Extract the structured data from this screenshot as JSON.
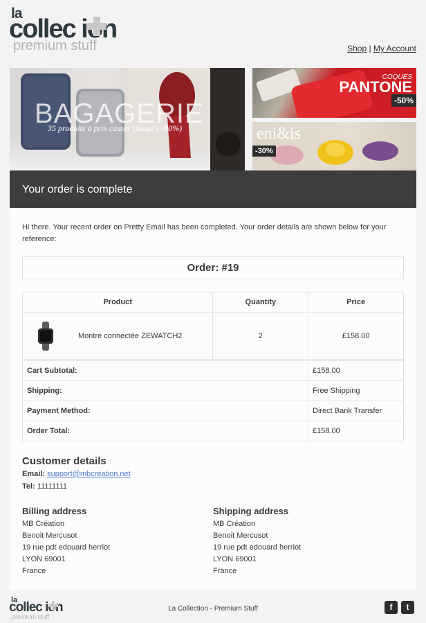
{
  "header": {
    "logo_top": "la",
    "logo_word": "collec ion",
    "logo_tagline": "premium stuff",
    "links": [
      {
        "label": "Shop"
      },
      {
        "label": "My Account"
      }
    ],
    "separator": "|"
  },
  "banner": {
    "main_title": "BAGAGERIE",
    "main_promo": "35 produits à prix cassés (jusqu'à -80%)",
    "right_top_small": "COQUES",
    "right_top_brand": "PANTONE",
    "right_top_discount": "-50%",
    "right_bottom_brand": "eni&is",
    "right_bottom_discount": "-30%"
  },
  "email": {
    "heading": "Your order is complete",
    "intro": "Hi there. Your recent order on Pretty Email has been completed. Your order details are shown below for your reference:",
    "order_label": "Order: #19"
  },
  "items_table": {
    "headers": [
      "Product",
      "Quantity",
      "Price"
    ],
    "rows": [
      {
        "product": "Montre connectée ZEWATCH2",
        "quantity": "2",
        "price": "£158.00",
        "icon": "smartwatch-icon"
      }
    ]
  },
  "totals": [
    {
      "label": "Cart Subtotal:",
      "value": "£158.00"
    },
    {
      "label": "Shipping:",
      "value": "Free Shipping"
    },
    {
      "label": "Payment Method:",
      "value": "Direct Bank Transfer"
    },
    {
      "label": "Order Total:",
      "value": "£158.00"
    }
  ],
  "customer": {
    "heading": "Customer details",
    "email_label": "Email:",
    "email_value": "support@mbcreation.net",
    "tel_label": "Tel:",
    "tel_value": "11111111"
  },
  "billing": {
    "heading": "Billing address",
    "lines": [
      "MB Création",
      "Benoit Mercusot",
      "19 rue pdt edouard herriot",
      "LYON 69001",
      "France"
    ]
  },
  "shipping": {
    "heading": "Shipping address",
    "lines": [
      "MB Création",
      "Benoit Mercusot",
      "19 rue pdt edouard herriot",
      "LYON 69001",
      "France"
    ]
  },
  "footer": {
    "logo_top": "la",
    "logo_word": "collec ion",
    "logo_tagline": "premium stuff",
    "text": "La Collection - Premium Stuff",
    "social": [
      {
        "name": "facebook-icon",
        "glyph": "f"
      },
      {
        "name": "twitter-icon",
        "glyph": "t"
      }
    ]
  },
  "colors": {
    "background": "#f3f3f3",
    "panel": "#fcfcfc",
    "title_bar": "#3d3d3d",
    "link": "#4f7ccf",
    "logo_dark": "#2f3a3f",
    "logo_light": "#b4b4b4"
  }
}
